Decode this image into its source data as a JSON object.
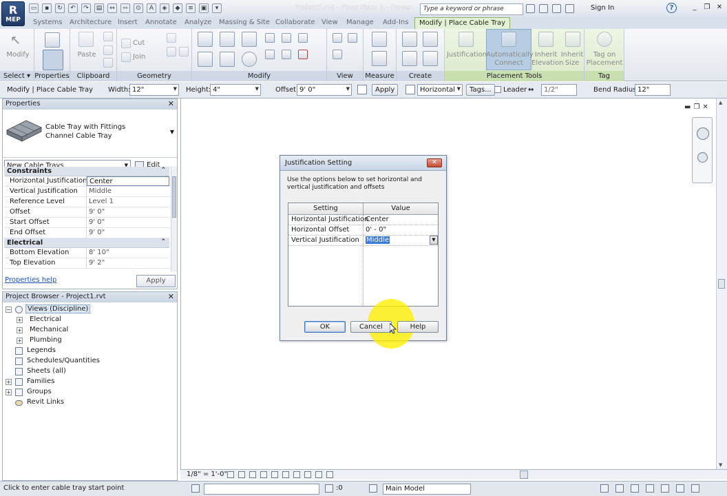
{
  "titlebar": {
    "app_letter": "R",
    "app_sub": "MEP",
    "title": "Project1.rvt - Floor Plan: 1 - Power",
    "search_placeholder": "Type a keyword or phrase",
    "signin": "Sign In"
  },
  "tabs": [
    "Systems",
    "Architecture",
    "Insert",
    "Annotate",
    "Analyze",
    "Massing & Site",
    "Collaborate",
    "View",
    "Manage",
    "Add-Ins",
    "Modify | Place Cable Tray"
  ],
  "ribbon": {
    "modify": "Modify",
    "paste": "Paste",
    "cut": "Cut",
    "join": "Join",
    "justification": "Justification",
    "auto_connect": "Automatically Connect",
    "inherit_elevation": "Inherit Elevation",
    "inherit_size": "Inherit Size",
    "tag_on_placement": "Tag on Placement",
    "panels": {
      "select": "Select ▾",
      "properties": "Properties",
      "clipboard": "Clipboard",
      "geometry": "Geometry",
      "modify": "Modify",
      "view": "View",
      "measure": "Measure",
      "create": "Create",
      "placement_tools": "Placement Tools",
      "tag": "Tag"
    }
  },
  "options_bar": {
    "context": "Modify | Place Cable Tray",
    "width_label": "Width:",
    "width_value": "12\"",
    "height_label": "Height:",
    "height_value": "4\"",
    "offset_label": "Offset:",
    "offset_value": "9'  0\"",
    "apply": "Apply",
    "horizontal": "Horizontal",
    "tags": "Tags...",
    "leader": "Leader",
    "leader_length": "1/2\"",
    "bend_radius_label": "Bend Radius:",
    "bend_radius_value": "12\""
  },
  "properties": {
    "title": "Properties",
    "type_family": "Cable Tray with Fittings",
    "type_name": "Channel Cable Tray",
    "instance_filter": "New Cable Trays",
    "edit_type": "Edit Type",
    "groups": [
      {
        "name": "Constraints",
        "rows": [
          {
            "k": "Horizontal Justification",
            "v": "Center"
          },
          {
            "k": "Vertical Justification",
            "v": "Middle"
          },
          {
            "k": "Reference Level",
            "v": "Level 1"
          },
          {
            "k": "Offset",
            "v": "9'  0\""
          },
          {
            "k": "Start Offset",
            "v": "9'  0\""
          },
          {
            "k": "End Offset",
            "v": "9'  0\""
          }
        ]
      },
      {
        "name": "Electrical",
        "rows": [
          {
            "k": "Bottom Elevation",
            "v": "8'  10\""
          },
          {
            "k": "Top Elevation",
            "v": "9'  2\""
          }
        ]
      }
    ],
    "help_link": "Properties help",
    "apply": "Apply"
  },
  "browser": {
    "title": "Project Browser - Project1.rvt",
    "nodes": {
      "views": "Views (Discipline)",
      "electrical": "Electrical",
      "mechanical": "Mechanical",
      "plumbing": "Plumbing",
      "legends": "Legends",
      "schedules": "Schedules/Quantities",
      "sheets": "Sheets (all)",
      "families": "Families",
      "groups": "Groups",
      "revit_links": "Revit Links"
    }
  },
  "viewbar": {
    "scale": "1/8\" = 1'-0\""
  },
  "statusbar": {
    "message": "Click to enter cable tray start point",
    "worksets": ":0",
    "model": "Main Model"
  },
  "dialog": {
    "title": "Justification Setting",
    "description": "Use the options below to set horizontal and vertical justification and offsets",
    "col_setting": "Setting",
    "col_value": "Value",
    "rows": [
      {
        "setting": "Horizontal Justification",
        "value": "Center"
      },
      {
        "setting": "Horizontal Offset",
        "value": "0' - 0\""
      },
      {
        "setting": "Vertical Justification",
        "value": "Middle"
      }
    ],
    "ok": "OK",
    "cancel": "Cancel",
    "help": "Help"
  },
  "colors": {
    "ribbon_bg": "#e2e7ee",
    "context_tab": "#e5f0d8",
    "selection_blue": "#3b7bd6",
    "highlight_yellow": "#fff000",
    "link_blue": "#1f4fb6"
  }
}
